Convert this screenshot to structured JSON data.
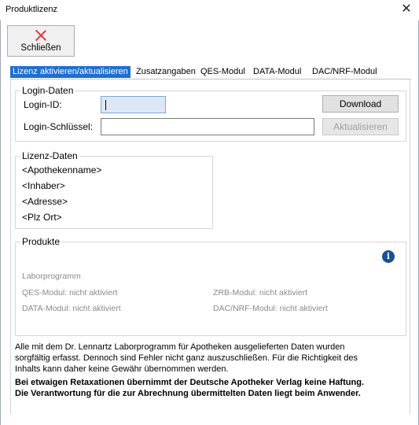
{
  "window": {
    "title": "Produktlizenz",
    "close_glyph": "✕"
  },
  "toolbar": {
    "close_label": "Schließen"
  },
  "tabs": [
    {
      "label": "Lizenz aktivieren/aktualisieren",
      "active": true
    },
    {
      "label": "Zusatzangaben",
      "active": false
    },
    {
      "label": "QES-Modul",
      "active": false
    },
    {
      "label": "DATA-Modul",
      "active": false
    },
    {
      "label": "DAC/NRF-Modul",
      "active": false
    }
  ],
  "login": {
    "group_title": "Login-Daten",
    "id_label": "Login-ID:",
    "id_value": "",
    "key_label": "Login-Schlüssel:",
    "key_value": "",
    "download_label": "Download",
    "update_label": "Aktualisieren"
  },
  "license": {
    "group_title": "Lizenz-Daten",
    "pharmacy": "<Apothekenname>",
    "owner": "<Inhaber>",
    "address": "<Adresse>",
    "zip_city": "<Plz Ort>"
  },
  "products": {
    "group_title": "Produkte",
    "info_glyph": "i",
    "items": {
      "labor": "Laborprogramm",
      "qes": "QES-Modul: nicht aktiviert",
      "zrb": "ZRB-Modul: nicht aktiviert",
      "data": "DATA-Modul: nicht aktiviert",
      "dacnrf": "DAC/NRF-Modul: nicht aktiviert"
    }
  },
  "disclaimer": {
    "line1": "Alle mit dem Dr. Lennartz Laborprogramm für Apotheken ausgelieferten Daten wurden",
    "line2": "sorgfältig erfasst. Dennoch sind Fehler nicht ganz auszuschließen. Für die Richtigkeit des",
    "line3": "Inhalts kann daher keine Gewähr übernommen werden.",
    "bold1": "Bei etwaigen Retaxationen übernimmt der Deutsche Apotheker Verlag keine Haftung.",
    "bold2": "Die Verantwortung für die zur Abrechnung übermittelten Daten liegt beim Anwender."
  }
}
